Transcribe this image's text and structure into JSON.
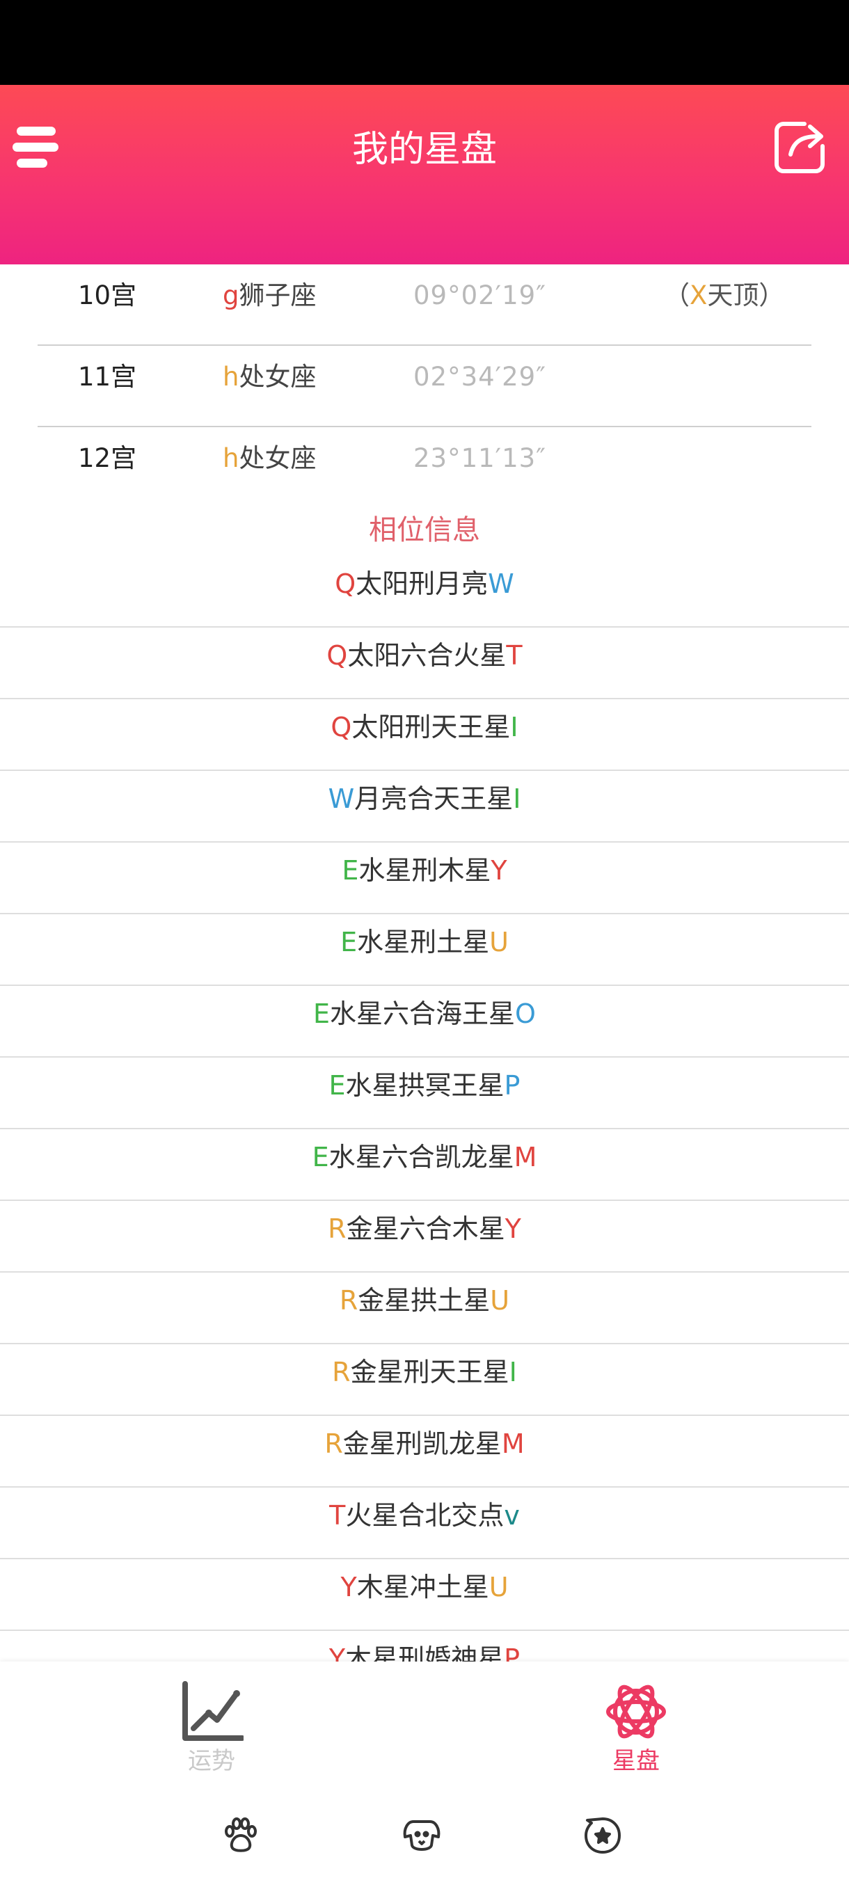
{
  "header": {
    "title": "我的星盘"
  },
  "houses": [
    {
      "house": "10宫",
      "glyph": "g",
      "glyph_color": "#e0443f",
      "sign": "狮子座",
      "degree": "09°02′19″",
      "note_open": "（",
      "note_glyph": "X",
      "note_glyph_color": "#e6a33a",
      "note_text": "天顶）"
    },
    {
      "house": "11宫",
      "glyph": "h",
      "glyph_color": "#e6a33a",
      "sign": "处女座",
      "degree": "02°34′29″",
      "note_open": "",
      "note_glyph": "",
      "note_glyph_color": "#e6a33a",
      "note_text": ""
    },
    {
      "house": "12宫",
      "glyph": "h",
      "glyph_color": "#e6a33a",
      "sign": "处女座",
      "degree": "23°11′13″",
      "note_open": "",
      "note_glyph": "",
      "note_glyph_color": "#e6a33a",
      "note_text": ""
    }
  ],
  "section_title": "相位信息",
  "aspects": [
    {
      "g1": "Q",
      "c1": "#e0443f",
      "text": "太阳刑月亮",
      "g2": "W",
      "c2": "#3a9bd5"
    },
    {
      "g1": "Q",
      "c1": "#e0443f",
      "text": "太阳六合火星",
      "g2": "T",
      "c2": "#e0443f"
    },
    {
      "g1": "Q",
      "c1": "#e0443f",
      "text": "太阳刑天王星",
      "g2": "I",
      "c2": "#41b549"
    },
    {
      "g1": "W",
      "c1": "#3a9bd5",
      "text": "月亮合天王星",
      "g2": "I",
      "c2": "#41b549"
    },
    {
      "g1": "E",
      "c1": "#41b549",
      "text": "水星刑木星",
      "g2": "Y",
      "c2": "#e0443f"
    },
    {
      "g1": "E",
      "c1": "#41b549",
      "text": "水星刑土星",
      "g2": "U",
      "c2": "#e6a33a"
    },
    {
      "g1": "E",
      "c1": "#41b549",
      "text": "水星六合海王星",
      "g2": "O",
      "c2": "#3a9bd5"
    },
    {
      "g1": "E",
      "c1": "#41b549",
      "text": "水星拱冥王星",
      "g2": "P",
      "c2": "#3a9bd5"
    },
    {
      "g1": "E",
      "c1": "#41b549",
      "text": "水星六合凯龙星",
      "g2": "M",
      "c2": "#e0443f"
    },
    {
      "g1": "R",
      "c1": "#e6a33a",
      "text": "金星六合木星",
      "g2": "Y",
      "c2": "#e0443f"
    },
    {
      "g1": "R",
      "c1": "#e6a33a",
      "text": "金星拱土星",
      "g2": "U",
      "c2": "#e6a33a"
    },
    {
      "g1": "R",
      "c1": "#e6a33a",
      "text": "金星刑天王星",
      "g2": "I",
      "c2": "#41b549"
    },
    {
      "g1": "R",
      "c1": "#e6a33a",
      "text": "金星刑凯龙星",
      "g2": "M",
      "c2": "#e0443f"
    },
    {
      "g1": "T",
      "c1": "#e0443f",
      "text": "火星合北交点",
      "g2": "v",
      "c2": "#1d8a8a"
    },
    {
      "g1": "Y",
      "c1": "#e0443f",
      "text": "木星冲土星",
      "g2": "U",
      "c2": "#e6a33a"
    },
    {
      "g1": "Y",
      "c1": "#e0443f",
      "text": "木星刑婚神星",
      "g2": "P",
      "c2": "#e0443f"
    }
  ],
  "tabs": [
    {
      "label": "运势",
      "icon": "trend-chart-icon",
      "active": false,
      "color": "#c9c9c9"
    },
    {
      "label": "星盘",
      "icon": "star-chart-icon",
      "active": true,
      "color": "#ec3a63"
    }
  ],
  "nav_icons": [
    "paw-icon",
    "dog-icon",
    "star-badge-icon"
  ]
}
